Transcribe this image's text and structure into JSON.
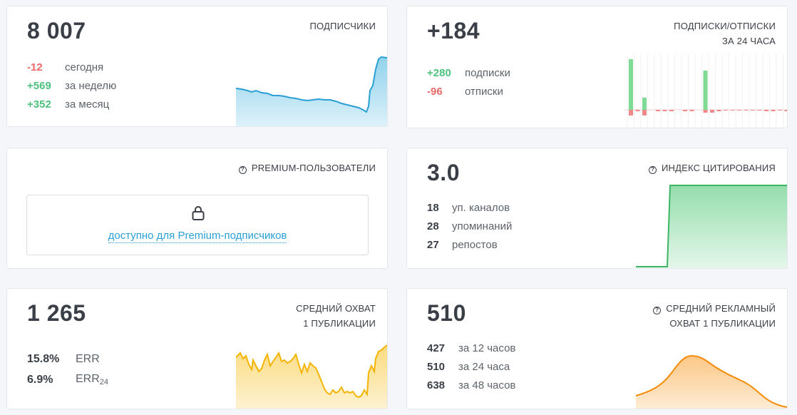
{
  "subscribers": {
    "title": "ПОДПИСЧИКИ",
    "value": "8 007",
    "stats": [
      {
        "value": "-12",
        "label": "сегодня",
        "tone": "red"
      },
      {
        "value": "+569",
        "label": "за неделю",
        "tone": "green"
      },
      {
        "value": "+352",
        "label": "за месяц",
        "tone": "green"
      }
    ]
  },
  "subs_unsubs": {
    "title_line1": "ПОДПИСКИ/ОТПИСКИ",
    "title_line2": "ЗА 24 ЧАСА",
    "value": "+184",
    "stats": [
      {
        "value": "+280",
        "label": "подписки",
        "tone": "green"
      },
      {
        "value": "-96",
        "label": "отписки",
        "tone": "red"
      }
    ]
  },
  "premium": {
    "title": "PREMIUM-ПОЛЬЗОВАТЕЛИ",
    "locked_text": "доступно для Premium-подписчиков"
  },
  "citation": {
    "title": "ИНДЕКС ЦИТИРОВАНИЯ",
    "value": "3.0",
    "stats": [
      {
        "value": "18",
        "label": "уп. каналов"
      },
      {
        "value": "28",
        "label": "упоминаний"
      },
      {
        "value": "27",
        "label": "репостов"
      }
    ]
  },
  "avg_reach": {
    "title_line1": "СРЕДНИЙ ОХВАТ",
    "title_line2": "1 ПУБЛИКАЦИИ",
    "value": "1 265",
    "stats": [
      {
        "value": "15.8%",
        "label": "ERR",
        "sub": ""
      },
      {
        "value": "6.9%",
        "label": "ERR",
        "sub": "24"
      }
    ]
  },
  "ad_reach": {
    "title_line1": "СРЕДНИЙ РЕКЛАМНЫЙ",
    "title_line2": "ОХВАТ 1 ПУБЛИКАЦИИ",
    "value": "510",
    "stats": [
      {
        "value": "427",
        "label": "за 12 часов"
      },
      {
        "value": "510",
        "label": "за 24 часа"
      },
      {
        "value": "638",
        "label": "за 48 часов"
      }
    ]
  },
  "colors": {
    "green": "#4cc27e",
    "red": "#ec6a6a",
    "blue": "#2a9fd6",
    "orange": "#f59a1f",
    "yellow": "#f5c02a"
  },
  "icons": {
    "question": "question-circle-icon",
    "lock": "lock-icon"
  }
}
